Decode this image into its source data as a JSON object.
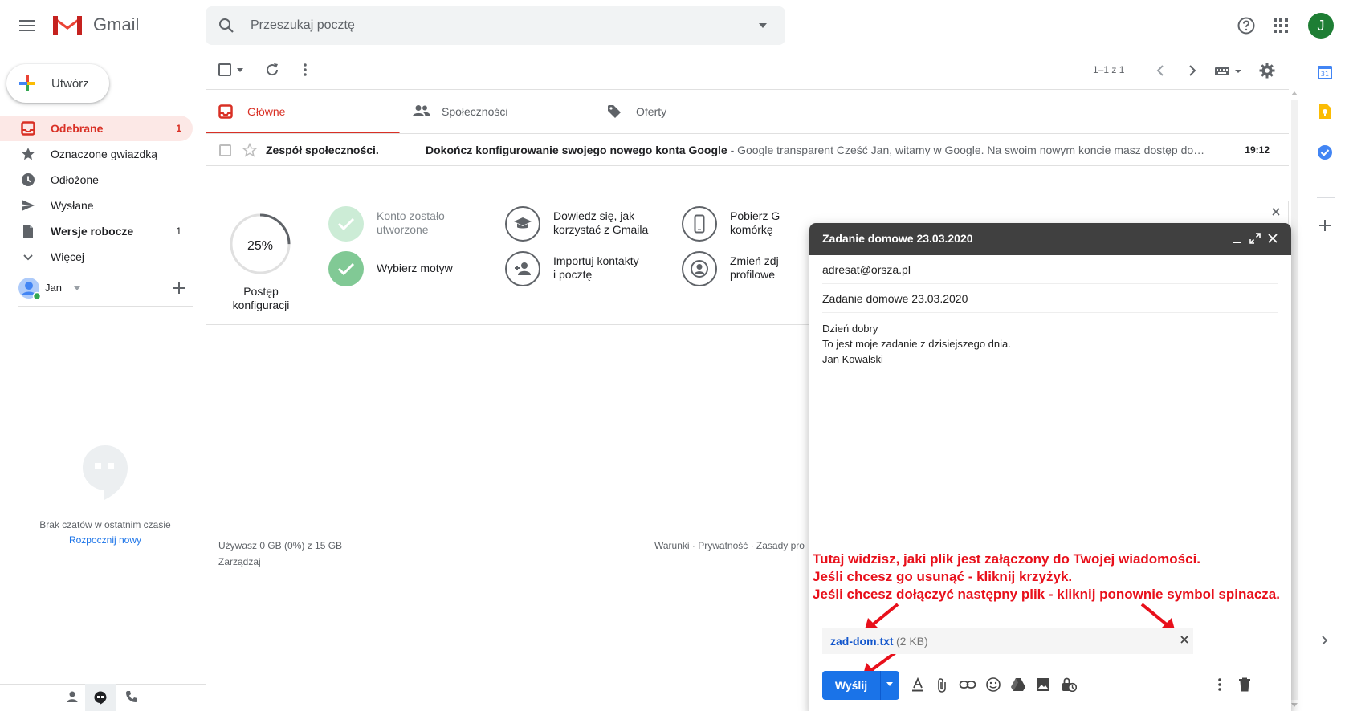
{
  "app": {
    "name": "Gmail",
    "avatar_letter": "J",
    "accent_color": "#d93025",
    "primary_color": "#1a73e8"
  },
  "search": {
    "placeholder": "Przeszukaj pocztę"
  },
  "sidebar": {
    "compose_label": "Utwórz",
    "items": [
      {
        "label": "Odebrane",
        "count": "1",
        "icon": "inbox-icon",
        "active": true
      },
      {
        "label": "Oznaczone gwiazdką",
        "count": "",
        "icon": "star-icon"
      },
      {
        "label": "Odłożone",
        "count": "",
        "icon": "clock-icon"
      },
      {
        "label": "Wysłane",
        "count": "",
        "icon": "send-icon"
      },
      {
        "label": "Wersje robocze",
        "count": "1",
        "icon": "draft-icon"
      },
      {
        "label": "Więcej",
        "count": "",
        "icon": "chevron-down-icon"
      }
    ],
    "hangouts": {
      "user": "Jan",
      "empty_text": "Brak czatów w ostatnim czasie",
      "start_link": "Rozpocznij nowy"
    }
  },
  "toolbar": {
    "pager": "1–1 z 1"
  },
  "tabs": [
    {
      "label": "Główne",
      "icon": "inbox-icon",
      "active": true
    },
    {
      "label": "Społeczności",
      "icon": "people-icon"
    },
    {
      "label": "Oferty",
      "icon": "tag-icon"
    }
  ],
  "emails": [
    {
      "sender": "Zespół społeczności.",
      "subject": "Dokończ konfigurowanie swojego nowego konta Google",
      "snippet": " - Google transparent Cześć Jan, witamy w Google. Na swoim nowym koncie masz dostęp do…",
      "time": "19:12"
    }
  ],
  "setup": {
    "progress_value": "25%",
    "progress_fraction": 0.25,
    "progress_label_1": "Postęp",
    "progress_label_2": "konfiguracji",
    "steps": [
      {
        "line1": "Konto zostało",
        "line2": "utworzone",
        "state": "done"
      },
      {
        "line1": "Wybierz motyw",
        "line2": "",
        "state": "done"
      },
      {
        "line1": "Dowiedz się, jak",
        "line2": "korzystać z Gmaila",
        "state": "todo"
      },
      {
        "line1": "Importuj kontakty",
        "line2": "i pocztę",
        "state": "todo"
      },
      {
        "line1": "Pobierz G",
        "line2": "komórkę",
        "state": "todo"
      },
      {
        "line1": "Zmień zdj",
        "line2": "profilowe",
        "state": "todo"
      }
    ]
  },
  "footer": {
    "storage": "Używasz 0 GB (0%) z 15 GB",
    "manage": "Zarządzaj",
    "links": "Warunki · Prywatność · Zasady pro"
  },
  "compose_window": {
    "title": "Zadanie domowe 23.03.2020",
    "to": "adresat@orsza.pl",
    "subject": "Zadanie domowe 23.03.2020",
    "body_lines": [
      "Dzień dobry",
      "To jest moje zadanie z dzisiejszego dnia.",
      "Jan Kowalski"
    ],
    "annotation_lines": [
      "Tutaj widzisz, jaki plik jest załączony do Twojej wiadomości.",
      "Jeśli chcesz go usunąć - kliknij krzyżyk.",
      "Jeśli chcesz dołączyć następny plik - kliknij ponownie symbol spinacza."
    ],
    "annotation_color": "#e8101b",
    "attachment": {
      "name": "zad-dom.txt",
      "size": "(2 KB)"
    },
    "send_label": "Wyślij"
  }
}
